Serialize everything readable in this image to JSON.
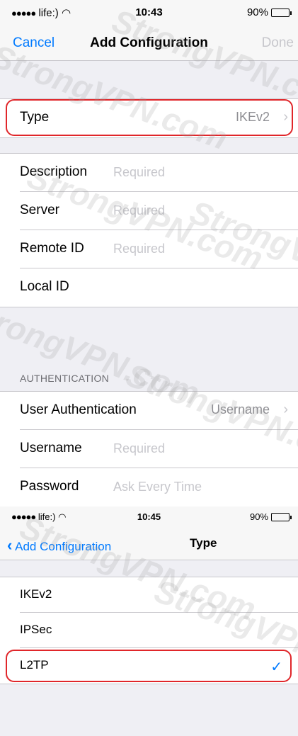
{
  "screen1": {
    "status": {
      "carrier": "life:)",
      "time": "10:43",
      "battery": "90%"
    },
    "nav": {
      "cancel": "Cancel",
      "title": "Add Configuration",
      "done": "Done"
    },
    "type_row": {
      "label": "Type",
      "value": "IKEv2"
    },
    "fields": [
      {
        "label": "Description",
        "placeholder": "Required"
      },
      {
        "label": "Server",
        "placeholder": "Required"
      },
      {
        "label": "Remote ID",
        "placeholder": "Required"
      },
      {
        "label": "Local ID",
        "placeholder": ""
      }
    ],
    "auth_header": "AUTHENTICATION",
    "auth": {
      "user_auth_label": "User Authentication",
      "user_auth_value": "Username",
      "username_label": "Username",
      "username_placeholder": "Required",
      "password_label": "Password",
      "password_placeholder": "Ask Every Time"
    }
  },
  "screen2": {
    "status": {
      "carrier": "life:)",
      "time": "10:45",
      "battery": "90%"
    },
    "nav": {
      "back": "Add Configuration",
      "title": "Type"
    },
    "options": [
      "IKEv2",
      "IPSec",
      "L2TP"
    ],
    "selected": "L2TP"
  },
  "watermark": "StrongVPN.com",
  "colors": {
    "accent": "#007aff",
    "highlight": "#e0262a",
    "placeholder": "#c7c7cc"
  }
}
